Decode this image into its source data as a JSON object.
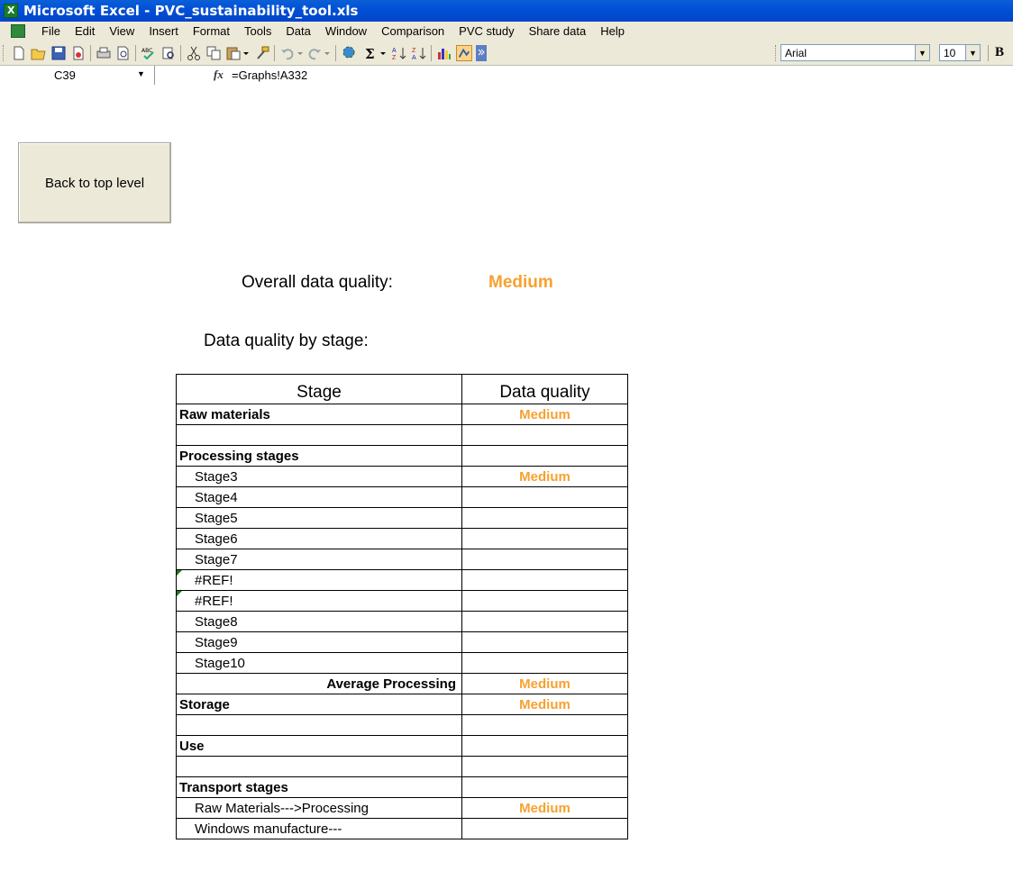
{
  "window": {
    "title": "Microsoft Excel - PVC_sustainability_tool.xls"
  },
  "menu": [
    "File",
    "Edit",
    "View",
    "Insert",
    "Format",
    "Tools",
    "Data",
    "Window",
    "Comparison",
    "PVC study",
    "Share data",
    "Help"
  ],
  "toolbar": {
    "font_name": "Arial",
    "font_size": "10",
    "bold_label": "B"
  },
  "formula_bar": {
    "cell_ref": "C39",
    "fx_label": "fx",
    "formula": "=Graphs!A332"
  },
  "sheet": {
    "back_button": "Back to top level",
    "overall_label": "Overall data quality:",
    "overall_value": "Medium",
    "bystage_label": "Data quality by stage:",
    "table": {
      "headers": [
        "Stage",
        "Data quality"
      ],
      "rows": [
        {
          "stage": "Raw materials",
          "quality": "Medium"
        },
        {
          "stage": "",
          "quality": ""
        },
        {
          "stage": "Processing stages",
          "quality": ""
        },
        {
          "stage": "Stage3",
          "quality": "Medium"
        },
        {
          "stage": "Stage4",
          "quality": ""
        },
        {
          "stage": "Stage5",
          "quality": ""
        },
        {
          "stage": "Stage6",
          "quality": ""
        },
        {
          "stage": "Stage7",
          "quality": ""
        },
        {
          "stage": "#REF!",
          "quality": ""
        },
        {
          "stage": "#REF!",
          "quality": ""
        },
        {
          "stage": "Stage8",
          "quality": ""
        },
        {
          "stage": "Stage9",
          "quality": ""
        },
        {
          "stage": "Stage10",
          "quality": ""
        },
        {
          "stage": "Average Processing",
          "quality": "Medium"
        },
        {
          "stage": "Storage",
          "quality": "Medium"
        },
        {
          "stage": "",
          "quality": ""
        },
        {
          "stage": "Use",
          "quality": ""
        },
        {
          "stage": "",
          "quality": ""
        },
        {
          "stage": "Transport stages",
          "quality": ""
        },
        {
          "stage": "Raw Materials--->Processing",
          "quality": "Medium"
        },
        {
          "stage": "Windows manufacture---",
          "quality": ""
        }
      ]
    }
  },
  "colors": {
    "quality_medium": "#f7a12f",
    "titlebar": "#0251d7",
    "chrome": "#ece9d8"
  }
}
